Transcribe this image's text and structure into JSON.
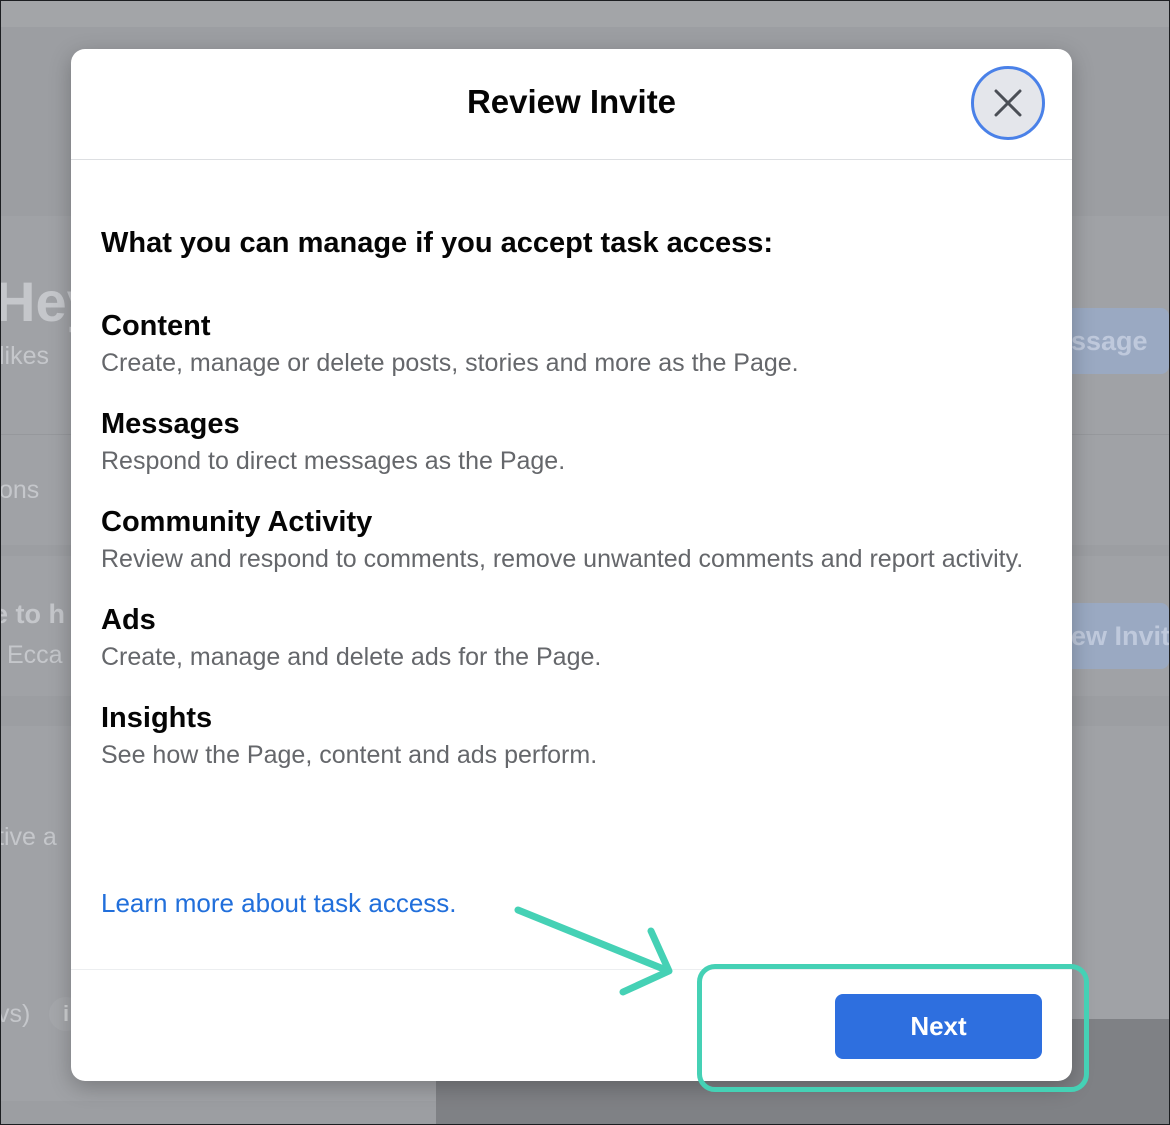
{
  "modal": {
    "title": "Review Invite",
    "close_icon": "close-icon",
    "lead": "What you can manage if you accept task access:",
    "sections": [
      {
        "title": "Content",
        "description": "Create, manage or delete posts, stories and more as the Page."
      },
      {
        "title": "Messages",
        "description": "Respond to direct messages as the Page."
      },
      {
        "title": "Community Activity",
        "description": "Review and respond to comments, remove unwanted comments and report activity."
      },
      {
        "title": "Ads",
        "description": "Create, manage and delete ads for the Page."
      },
      {
        "title": "Insights",
        "description": "See how the Page, content and ads perform."
      }
    ],
    "learn_more": "Learn more about task access.",
    "next_label": "Next"
  },
  "background": {
    "fragments": [
      "Hey",
      "likes",
      "ons",
      "e to h",
      "Ecca",
      "tive a",
      "vs)",
      "ssage",
      "ew Invit",
      "i"
    ]
  },
  "annotation": {
    "highlight_color": "#45d1b5",
    "arrow_icon": "arrow-icon"
  },
  "colors": {
    "primary_button": "#2e6fdf",
    "link": "#216fdb",
    "close_ring": "#4a81e8"
  }
}
